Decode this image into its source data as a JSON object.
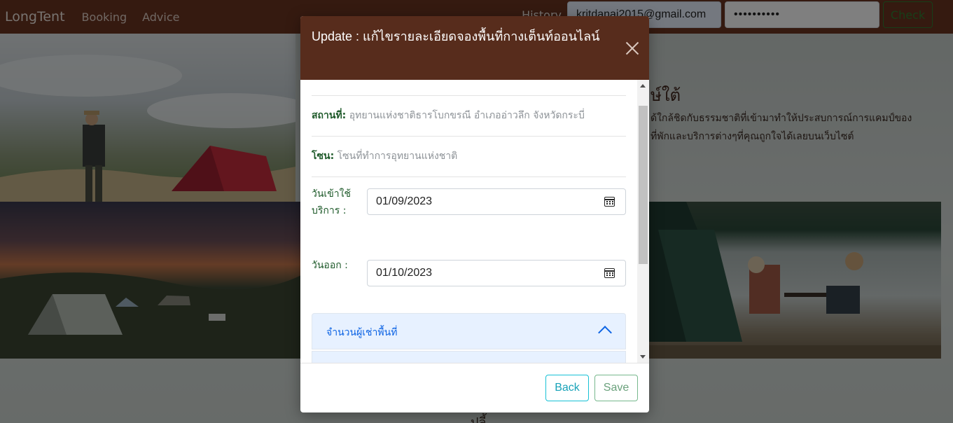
{
  "navbar": {
    "brand": "LongTent",
    "links": [
      "Booking",
      "Advice"
    ],
    "history_label": "History",
    "email_value": "kritdanai2015@gmail.com",
    "password_value": "••••••••••",
    "check_label": "Check"
  },
  "background": {
    "hero_title": "ษ์ใต้",
    "hero_text_1": "ด้ใกล้ชิดกับธรรมชาติที่เข้ามาทำให้ประสบการณ์การแคมป์ของ",
    "hero_text_2": "ที่พักและบริการต่างๆที่คุณถูกใจได้เลยบนเว็บไซต์",
    "bottom_fragment": "ปลี้"
  },
  "modal": {
    "title": "Update : แก้ไขรายละเอียดจองพื้นที่กางเต็นท์ออนไลน์",
    "location_label": "สถานที่:",
    "location_value": "อุทยานแห่งชาติธารโบกขรณี อำเภออ่าวลึก จังหวัดกระบี่",
    "zone_label": "โซน:",
    "zone_value": "โซนที่ทำการอุทยานแห่งชาติ",
    "checkin_label": "วันเข้าใช้บริการ :",
    "checkin_value": "01/09/2023",
    "checkout_label": "วันออก :",
    "checkout_value": "01/10/2023",
    "accordion_label": "จำนวนผู้เช่าพื้นที่",
    "back_label": "Back",
    "save_label": "Save"
  },
  "colors": {
    "navbar": "#6b3520",
    "modal_header": "#572c1c",
    "label_green": "#1e5a2a",
    "accordion_bg": "#e7f1ff",
    "accordion_text": "#0c63e4"
  }
}
